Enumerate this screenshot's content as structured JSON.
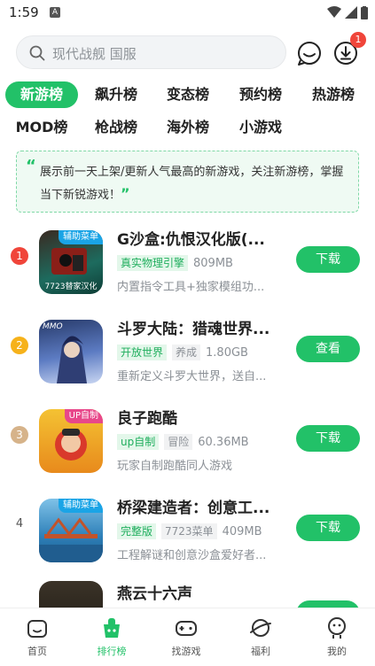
{
  "status": {
    "time": "1:59",
    "notif_letter": "A"
  },
  "search": {
    "placeholder": "现代战舰 国服"
  },
  "header": {
    "download_badge": "1"
  },
  "tabs": [
    {
      "label": "新游榜",
      "active": true
    },
    {
      "label": "飙升榜"
    },
    {
      "label": "变态榜"
    },
    {
      "label": "预约榜"
    },
    {
      "label": "热游榜"
    },
    {
      "label": "MOD榜"
    },
    {
      "label": "枪战榜"
    },
    {
      "label": "海外榜"
    },
    {
      "label": "小游戏"
    }
  ],
  "banner": {
    "text": "展示前一天上架/更新人气最高的新游戏，关注新游榜，掌握当下新锐游戏！",
    "quote_open": "“",
    "quote_close": "”"
  },
  "apps": [
    {
      "rank": "1",
      "title": "G沙盒:仇恨汉化版(...",
      "icon_badge": "辅助菜单",
      "icon_caption": "7723替家汉化",
      "tags": [
        "真实物理引擎"
      ],
      "size": "809MB",
      "desc": "内置指令工具+独家模组功...",
      "button": "下载"
    },
    {
      "rank": "2",
      "title": "斗罗大陆：猎魂世界...",
      "icon_badge": "",
      "icon_caption": "MMO",
      "tags": [
        "开放世界"
      ],
      "gray_tags": [
        "养成"
      ],
      "size": "1.80GB",
      "desc": "重新定义斗罗大世界，送自...",
      "button": "查看"
    },
    {
      "rank": "3",
      "title": "良子跑酷",
      "icon_badge": "UP自制",
      "icon_caption": "",
      "tags": [
        "up自制"
      ],
      "gray_tags": [
        "冒险"
      ],
      "size": "60.36MB",
      "desc": "玩家自制跑酷同人游戏",
      "button": "下载"
    },
    {
      "rank": "4",
      "title": "桥梁建造者：创意工...",
      "icon_badge": "辅助菜单",
      "icon_caption": "",
      "tags": [
        "完整版"
      ],
      "gray_tags": [
        "7723菜单"
      ],
      "size": "409MB",
      "desc": "工程解谜和创意沙盒爱好者...",
      "button": "下载"
    },
    {
      "rank": "",
      "title": "燕云十六声",
      "icon_badge": "",
      "icon_caption": "",
      "tags": [],
      "size": "",
      "desc": "",
      "button": ""
    }
  ],
  "nav": [
    {
      "label": "首页",
      "icon": "home-icon"
    },
    {
      "label": "排行榜",
      "icon": "ranking-icon",
      "active": true
    },
    {
      "label": "找游戏",
      "icon": "gamepad-icon"
    },
    {
      "label": "福利",
      "icon": "planet-icon"
    },
    {
      "label": "我的",
      "icon": "profile-icon"
    }
  ],
  "colors": {
    "accent": "#22c168",
    "rank1": "#f0453a",
    "rank2": "#f6b21b",
    "rank3": "#d6b38a"
  }
}
